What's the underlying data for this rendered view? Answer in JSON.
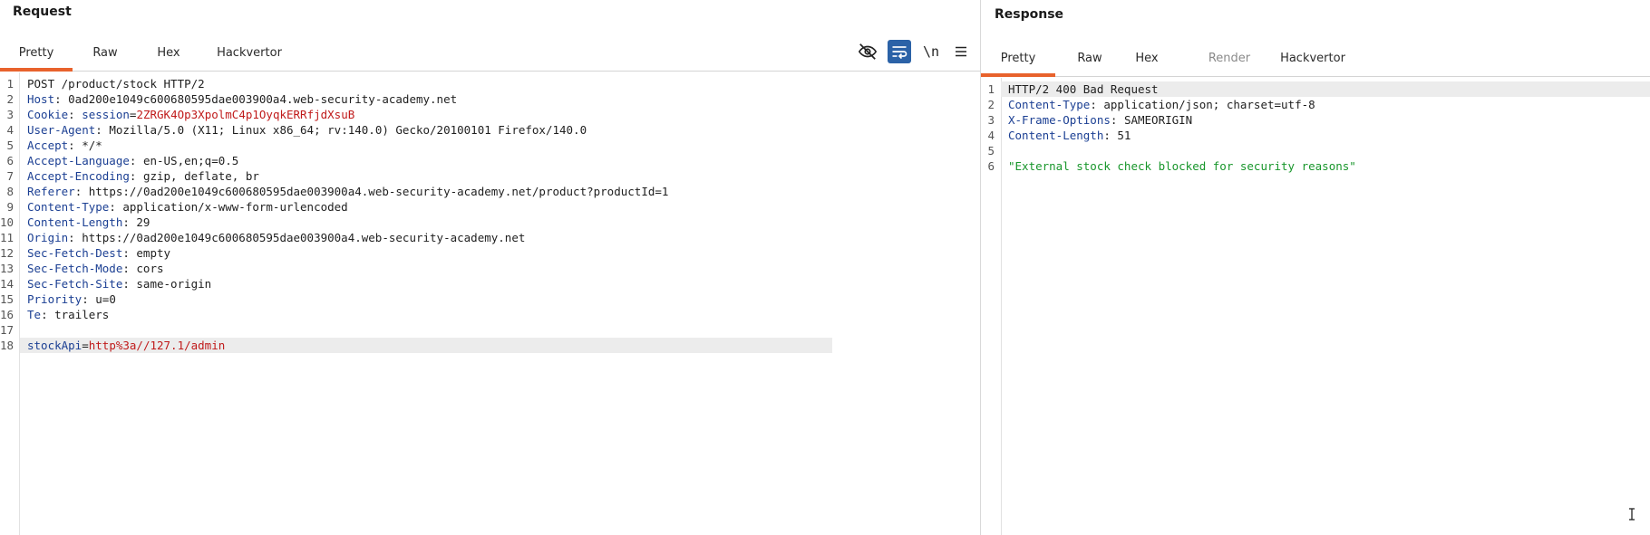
{
  "request": {
    "title": "Request",
    "tabs": [
      {
        "label": "Pretty",
        "active": true
      },
      {
        "label": "Raw",
        "active": false
      },
      {
        "label": "Hex",
        "active": false
      },
      {
        "label": "Hackvertor",
        "active": false
      }
    ],
    "toolbar": {
      "hide_icon": "eye-off-icon",
      "wrap_icon": "word-wrap-icon",
      "newline_label": "\\n",
      "menu_icon": "hamburger-menu-icon"
    },
    "lines": [
      {
        "n": "1",
        "parts": [
          {
            "t": "POST /product/stock HTTP/2",
            "c": "v"
          }
        ]
      },
      {
        "n": "2",
        "parts": [
          {
            "t": "Host",
            "c": "k"
          },
          {
            "t": ": 0ad200e1049c600680595dae003900a4.web-security-academy.net",
            "c": "v"
          }
        ]
      },
      {
        "n": "3",
        "parts": [
          {
            "t": "Cookie",
            "c": "k"
          },
          {
            "t": ": ",
            "c": "v"
          },
          {
            "t": "session",
            "c": "k"
          },
          {
            "t": "=",
            "c": "v"
          },
          {
            "t": "2ZRGK4Op3XpolmC4p1OyqkERRfjdXsuB",
            "c": "r"
          }
        ]
      },
      {
        "n": "4",
        "parts": [
          {
            "t": "User-Agent",
            "c": "k"
          },
          {
            "t": ": Mozilla/5.0 (X11; Linux x86_64; rv:140.0) Gecko/20100101 Firefox/140.0",
            "c": "v"
          }
        ]
      },
      {
        "n": "5",
        "parts": [
          {
            "t": "Accept",
            "c": "k"
          },
          {
            "t": ": */*",
            "c": "v"
          }
        ]
      },
      {
        "n": "6",
        "parts": [
          {
            "t": "Accept-Language",
            "c": "k"
          },
          {
            "t": ": en-US,en;q=0.5",
            "c": "v"
          }
        ]
      },
      {
        "n": "7",
        "parts": [
          {
            "t": "Accept-Encoding",
            "c": "k"
          },
          {
            "t": ": gzip, deflate, br",
            "c": "v"
          }
        ]
      },
      {
        "n": "8",
        "parts": [
          {
            "t": "Referer",
            "c": "k"
          },
          {
            "t": ": https://0ad200e1049c600680595dae003900a4.web-security-academy.net/product?productId=1",
            "c": "v"
          }
        ]
      },
      {
        "n": "9",
        "parts": [
          {
            "t": "Content-Type",
            "c": "k"
          },
          {
            "t": ": application/x-www-form-urlencoded",
            "c": "v"
          }
        ]
      },
      {
        "n": "10",
        "parts": [
          {
            "t": "Content-Length",
            "c": "k"
          },
          {
            "t": ": 29",
            "c": "v"
          }
        ]
      },
      {
        "n": "11",
        "parts": [
          {
            "t": "Origin",
            "c": "k"
          },
          {
            "t": ": https://0ad200e1049c600680595dae003900a4.web-security-academy.net",
            "c": "v"
          }
        ]
      },
      {
        "n": "12",
        "parts": [
          {
            "t": "Sec-Fetch-Dest",
            "c": "k"
          },
          {
            "t": ": empty",
            "c": "v"
          }
        ]
      },
      {
        "n": "13",
        "parts": [
          {
            "t": "Sec-Fetch-Mode",
            "c": "k"
          },
          {
            "t": ": cors",
            "c": "v"
          }
        ]
      },
      {
        "n": "14",
        "parts": [
          {
            "t": "Sec-Fetch-Site",
            "c": "k"
          },
          {
            "t": ": same-origin",
            "c": "v"
          }
        ]
      },
      {
        "n": "15",
        "parts": [
          {
            "t": "Priority",
            "c": "k"
          },
          {
            "t": ": u=0",
            "c": "v"
          }
        ]
      },
      {
        "n": "16",
        "parts": [
          {
            "t": "Te",
            "c": "k"
          },
          {
            "t": ": trailers",
            "c": "v"
          }
        ]
      },
      {
        "n": "17",
        "parts": []
      },
      {
        "n": "18",
        "hl": true,
        "parts": [
          {
            "t": "stockApi",
            "c": "k"
          },
          {
            "t": "=",
            "c": "v"
          },
          {
            "t": "http%3a//127.1/admin",
            "c": "r"
          }
        ]
      }
    ]
  },
  "response": {
    "title": "Response",
    "tabs": [
      {
        "label": "Pretty",
        "active": true
      },
      {
        "label": "Raw",
        "active": false
      },
      {
        "label": "Hex",
        "active": false
      },
      {
        "label": "Render",
        "active": false,
        "dim": true
      },
      {
        "label": "Hackvertor",
        "active": false
      }
    ],
    "lines": [
      {
        "n": "1",
        "hl": true,
        "parts": [
          {
            "t": "HTTP/2 400 Bad Request",
            "c": "v"
          }
        ]
      },
      {
        "n": "2",
        "parts": [
          {
            "t": "Content-Type",
            "c": "k"
          },
          {
            "t": ": application/json; charset=utf-8",
            "c": "v"
          }
        ]
      },
      {
        "n": "3",
        "parts": [
          {
            "t": "X-Frame-Options",
            "c": "k"
          },
          {
            "t": ": SAMEORIGIN",
            "c": "v"
          }
        ]
      },
      {
        "n": "4",
        "parts": [
          {
            "t": "Content-Length",
            "c": "k"
          },
          {
            "t": ": 51",
            "c": "v"
          }
        ]
      },
      {
        "n": "5",
        "parts": []
      },
      {
        "n": "6",
        "parts": [
          {
            "t": "\"External stock check blocked for security reasons\"",
            "c": "g"
          }
        ]
      }
    ],
    "cursor_icon": "text-cursor-icon"
  },
  "colors": {
    "accent": "#e8622c",
    "header_key": "#1b3f93",
    "value_red": "#c01a1a",
    "string_green": "#18962b",
    "toggle_on": "#2b62a7"
  }
}
